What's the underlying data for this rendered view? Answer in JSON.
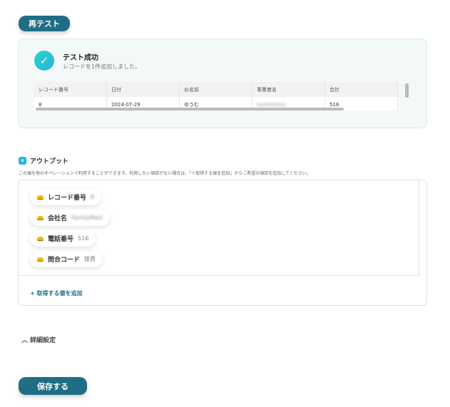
{
  "retest_label": "再テスト",
  "result": {
    "title": "テスト成功",
    "message": "レコードを1件追加しました。",
    "columns": [
      "レコード番号",
      "日付",
      "お名前",
      "事業者名",
      "合計"
    ],
    "row": [
      "8",
      "2024-07-29",
      "ゆうむ",
      "Kurokkibiee",
      "516"
    ]
  },
  "output": {
    "title": "アウトプット",
    "description": "この値を他のオペレーションで利用することができます。利用したい項目がない場合は、「＋取得する値を追加」からご希望の項目を追加してください。",
    "items": [
      {
        "label": "レコード番号",
        "value": "8"
      },
      {
        "label": "会社名",
        "value": "FamilyMart"
      },
      {
        "label": "電話番号",
        "value": "516"
      },
      {
        "label": "問合コード",
        "value": "雑費"
      }
    ],
    "add_label": "+ 取得する値を追加"
  },
  "advanced_label": "詳細設定",
  "save_label": "保存する"
}
